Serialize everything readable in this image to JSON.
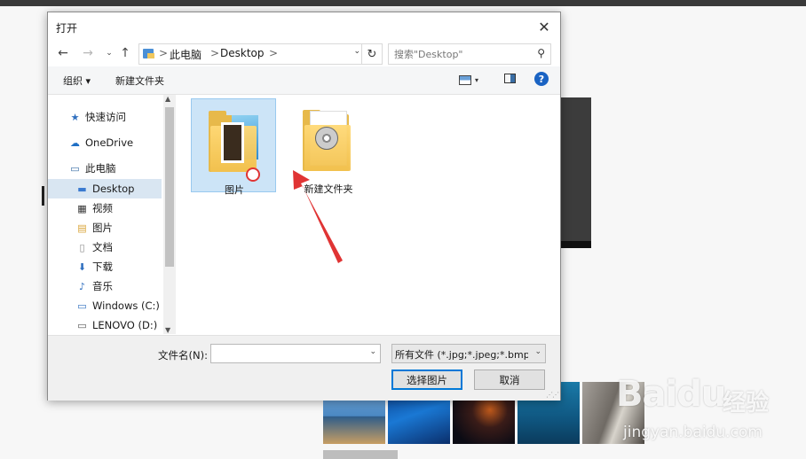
{
  "dialog": {
    "title": "打开",
    "close_glyph": "✕"
  },
  "nav": {
    "back_glyph": "←",
    "forward_glyph": "→",
    "recent_glyph": "⌄",
    "up_glyph": "↑",
    "refresh_glyph": "↻",
    "address": {
      "crumbs": [
        "此电脑",
        "Desktop"
      ],
      "separator": ">",
      "dropdown_glyph": "⌄"
    },
    "search": {
      "placeholder": "搜索\"Desktop\"",
      "icon": "search-icon"
    }
  },
  "toolbar": {
    "organize_label": "组织 ▾",
    "new_folder_label": "新建文件夹",
    "help_glyph": "?"
  },
  "navpane": {
    "items": [
      {
        "label": "快速访问",
        "icon": "star-icon"
      },
      {
        "label": "OneDrive",
        "icon": "cloud-icon"
      },
      {
        "label": "此电脑",
        "icon": "computer-icon"
      },
      {
        "label": "Desktop",
        "icon": "desktop-folder-icon",
        "selected": true
      },
      {
        "label": "视频",
        "icon": "video-folder-icon"
      },
      {
        "label": "图片",
        "icon": "pictures-folder-icon"
      },
      {
        "label": "文档",
        "icon": "documents-folder-icon"
      },
      {
        "label": "下载",
        "icon": "downloads-folder-icon"
      },
      {
        "label": "音乐",
        "icon": "music-folder-icon"
      },
      {
        "label": "Windows (C:)",
        "icon": "drive-icon"
      },
      {
        "label": "LENOVO (D:)",
        "icon": "drive-icon"
      }
    ]
  },
  "files": [
    {
      "label": "图片",
      "selected": true
    },
    {
      "label": "新建文件夹",
      "selected": false
    }
  ],
  "bottom": {
    "filename_label": "文件名(N):",
    "filename_value": "",
    "filter_value": "所有文件 (*.jpg;*.jpeg;*.bmp;",
    "open_label": "选择图片",
    "cancel_label": "取消"
  },
  "watermark": {
    "logo": "Baidu",
    "text": "经验",
    "url": "jingyan.baidu.com"
  },
  "colors": {
    "accent": "#0078d7",
    "selection": "#cce4f7",
    "annotation_arrow": "#e03434"
  }
}
